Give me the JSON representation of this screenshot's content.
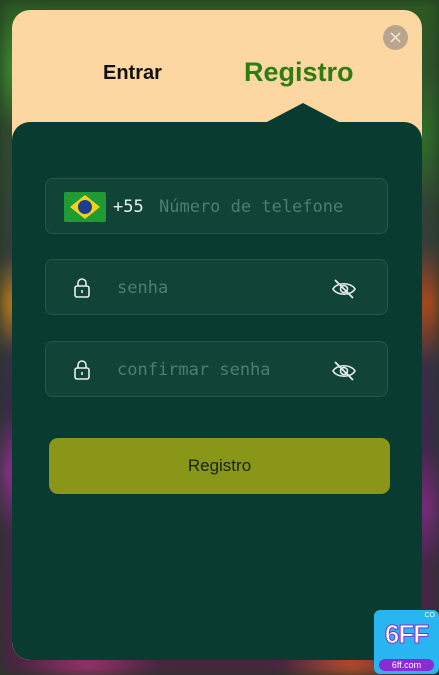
{
  "modal": {
    "close_label": "×",
    "tabs": {
      "login": "Entrar",
      "register": "Registro"
    }
  },
  "form": {
    "country_code": "+55",
    "phone_placeholder": "Número de telefone",
    "password_placeholder": "senha",
    "confirm_password_placeholder": "confirmar senha",
    "submit_label": "Registro"
  },
  "brand": {
    "logo": "6FF",
    "url": "6ff.com",
    "badge": "CO"
  },
  "icons": {
    "flag": "brazil-flag-icon",
    "lock": "lock-icon",
    "eye": "eye-off-icon",
    "close": "close-icon"
  },
  "colors": {
    "modal_bg": "#fdd7a2",
    "panel_bg": "#093b31",
    "active_tab": "#2e7d11",
    "submit_bg": "#8a9618"
  }
}
